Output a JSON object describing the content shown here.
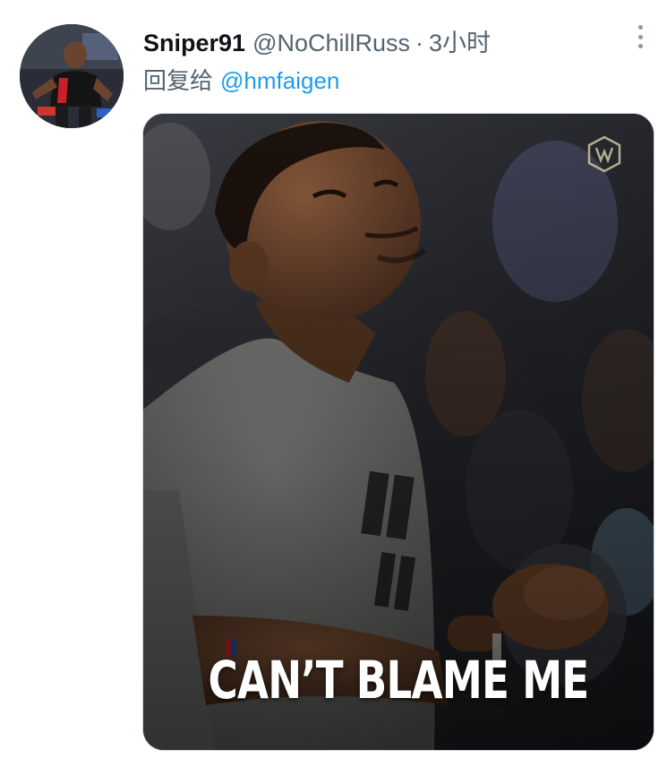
{
  "tweet": {
    "author": {
      "display_name": "Sniper91",
      "handle": "@NoChillRuss",
      "separator": "·",
      "time": "3小时"
    },
    "reply": {
      "prefix": "回复给",
      "mention": "@hmfaigen"
    },
    "media": {
      "caption": "CAN’T BLAME ME"
    }
  },
  "icons": {
    "more": "more-options-icon",
    "logo": "watermark-logo-icon"
  },
  "colors": {
    "link": "#1d9bf0",
    "secondary_text": "#536471",
    "primary_text": "#0f1419"
  }
}
